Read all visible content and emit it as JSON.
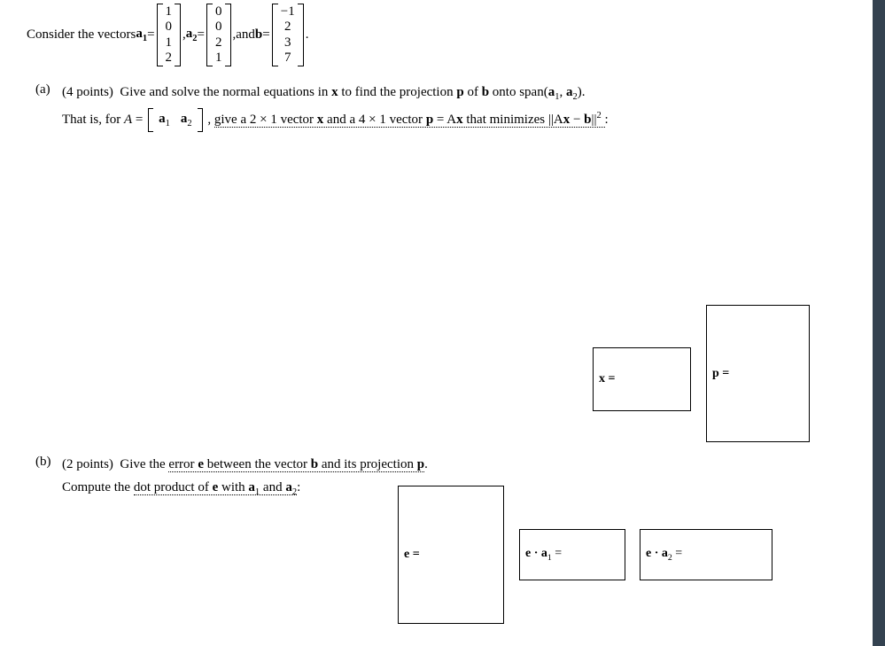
{
  "intro": {
    "lead": "Consider the vectors ",
    "a1_label": "a",
    "a1_sub": "1",
    "a2_label": "a",
    "a2_sub": "2",
    "b_label": "b",
    "eq": " = ",
    "sep": " , ",
    "and": " and ",
    "period": ".",
    "a1": [
      "1",
      "0",
      "1",
      "2"
    ],
    "a2": [
      "0",
      "0",
      "2",
      "1"
    ],
    "b": [
      "−1",
      "2",
      "3",
      "7"
    ]
  },
  "partA": {
    "tag": "(a)",
    "points": "(4 points)",
    "line1a": "Give and solve the normal equations in ",
    "x": "x",
    "line1b": " to find the projection ",
    "p": "p",
    "line1c": " of ",
    "b": "b",
    "line1d": " onto span",
    "span_open": "(",
    "a1": "a",
    "a1_sub": "1",
    "comma": ", ",
    "a2": "a",
    "a2_sub": "2",
    "span_close": ").",
    "line2a": "That is, for ",
    "A": "A",
    "eq": " = ",
    "row_a1": "a",
    "row_a1_sub": "1",
    "row_a2": "a",
    "row_a2_sub": "2",
    "line2b": "give a 2 × 1 vector ",
    "line2c": " and a 4 × 1 vector ",
    "peq": " = A",
    "line2d": " that minimizes ",
    "norm1": "||A",
    "norm2": " − ",
    "norm3": "||",
    "sq": "2",
    "colon": ":"
  },
  "partB": {
    "tag": "(b)",
    "points": "(2 points)",
    "line1a": "Give the ",
    "u1": "error ",
    "e": "e",
    "u1b": " between the vector ",
    "b": "b",
    "u1c": " and its projection ",
    "p": "p",
    "period": ".",
    "line2a": "Compute the ",
    "u2": "dot product of ",
    "u2b": " with ",
    "a1": "a",
    "a1_sub": "1",
    "and": " and ",
    "a2": "a",
    "a2_sub": "2",
    "colon": ":"
  },
  "boxes": {
    "x": "x =",
    "p": "p =",
    "e": "e =",
    "ea1_pre": "e · a",
    "ea1_sub": "1",
    "ea2_pre": "e · a",
    "ea2_sub": "2",
    "eq": " ="
  }
}
